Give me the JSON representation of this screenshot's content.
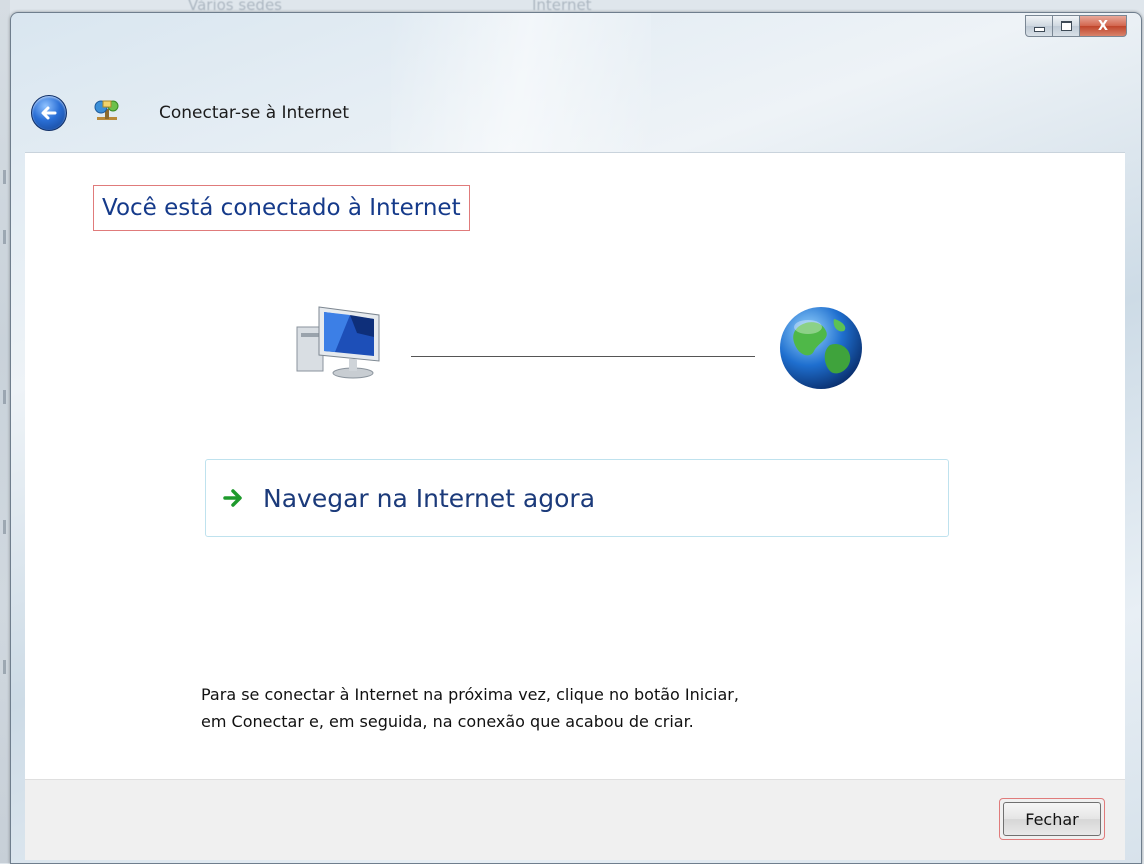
{
  "background": {
    "desktop_text_left": "Vários sedes",
    "desktop_text_right": "Internet"
  },
  "window": {
    "title": "Conectar-se à Internet",
    "caption_buttons": {
      "minimize_icon": "minimize-icon",
      "maximize_icon": "maximize-icon",
      "close_icon": "close-icon",
      "close_glyph": "X"
    }
  },
  "content": {
    "headline": "Você está conectado à Internet",
    "diagram": {
      "left_icon": "computer-icon",
      "right_icon": "globe-icon"
    },
    "browse_option": {
      "icon": "green-arrow-icon",
      "label": "Navegar na Internet agora"
    },
    "hint_line_1": "Para se conectar à Internet na próxima vez, clique no botão Iniciar,",
    "hint_line_2": "em Conectar e, em seguida, na conexão que acabou de criar."
  },
  "footer": {
    "close_button_label": "Fechar"
  },
  "colors": {
    "headline": "#153a8a",
    "highlight_border": "#e07b7b",
    "option_border": "#bfe2ee",
    "footer_bg": "#f0f0f0"
  }
}
